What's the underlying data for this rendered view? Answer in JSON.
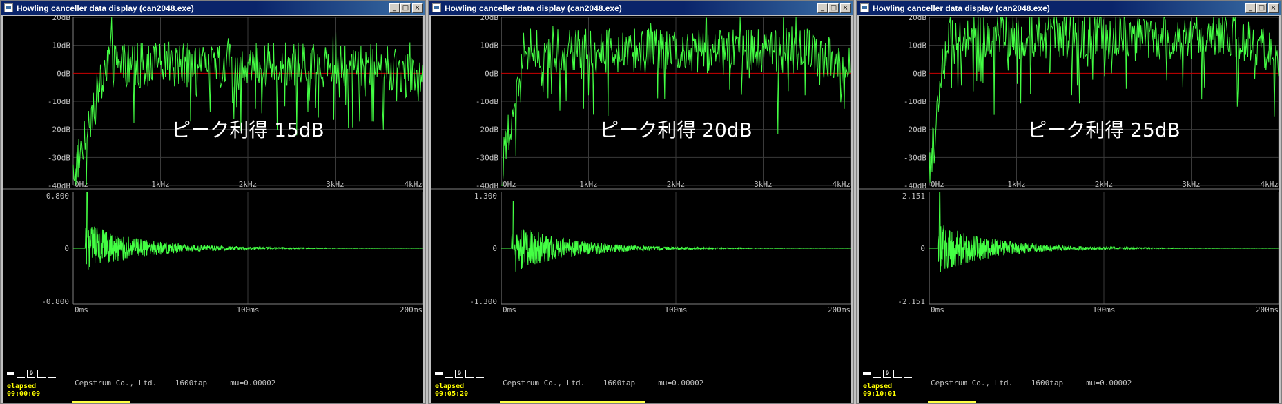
{
  "title_prefix": "Howling canceller data display (can2048.exe)",
  "window_buttons": {
    "minimize": "_",
    "maximize": "□",
    "close": "×"
  },
  "colors": {
    "trace": "#44ff44",
    "zero_line": "#cc0000",
    "grid": "#3a3a3a",
    "axis_text": "#c0c0c0",
    "elapsed_text": "#ffff00"
  },
  "status_icons": [
    "▬",
    "_",
    "9",
    "_",
    "_"
  ],
  "windows": [
    {
      "title": "Howling canceller data display (can2048.exe)",
      "overlay_label": "ピーク利得 15dB",
      "company": "Cepstrum Co., Ltd.",
      "taps": "1600tap",
      "mu": "mu=0.00002",
      "elapsed_label": "elapsed",
      "elapsed_time": "09:00:09",
      "progress_fraction": 0.17,
      "spectrum": {
        "y_ticks": [
          "20dB",
          "10dB",
          "0dB",
          "-10dB",
          "-20dB",
          "-30dB",
          "-40dB"
        ],
        "x_ticks": [
          "0Hz",
          "1kHz",
          "2kHz",
          "3kHz",
          "4kHz"
        ],
        "ylim": [
          -40,
          20
        ],
        "xlim": [
          0,
          4000
        ],
        "peak_db": 15,
        "rise_hz": 450
      },
      "cepstrum": {
        "y_ticks": [
          "0.800",
          "0",
          "-0.800"
        ],
        "x_ticks": [
          "0ms",
          "100ms",
          "200ms"
        ],
        "ylim": [
          -0.8,
          0.8
        ],
        "xlim": [
          0,
          200
        ],
        "peak_value": 0.8,
        "peak_ms": 8
      }
    },
    {
      "title": "Howling canceller data display (can2048.exe)",
      "overlay_label": "ピーク利得 20dB",
      "company": "Cepstrum Co., Ltd.",
      "taps": "1600tap",
      "mu": "mu=0.00002",
      "elapsed_label": "elapsed",
      "elapsed_time": "09:05:20",
      "progress_fraction": 0.42,
      "spectrum": {
        "y_ticks": [
          "20dB",
          "10dB",
          "0dB",
          "-10dB",
          "-20dB",
          "-30dB",
          "-40dB"
        ],
        "x_ticks": [
          "0Hz",
          "1kHz",
          "2kHz",
          "3kHz",
          "4kHz"
        ],
        "ylim": [
          -40,
          20
        ],
        "xlim": [
          0,
          4000
        ],
        "peak_db": 20,
        "rise_hz": 300
      },
      "cepstrum": {
        "y_ticks": [
          "1.300",
          "0",
          "-1.300"
        ],
        "x_ticks": [
          "0ms",
          "100ms",
          "200ms"
        ],
        "ylim": [
          -1.3,
          1.3
        ],
        "xlim": [
          0,
          200
        ],
        "peak_value": 1.1,
        "peak_ms": 7
      }
    },
    {
      "title": "Howling canceller data display (can2048.exe)",
      "overlay_label": "ピーク利得 25dB",
      "company": "Cepstrum Co., Ltd.",
      "taps": "1600tap",
      "mu": "mu=0.00002",
      "elapsed_label": "elapsed",
      "elapsed_time": "09:10:01",
      "progress_fraction": 0.14,
      "spectrum": {
        "y_ticks": [
          "20dB",
          "10dB",
          "0dB",
          "-10dB",
          "-20dB",
          "-30dB",
          "-40dB"
        ],
        "x_ticks": [
          "0Hz",
          "1kHz",
          "2kHz",
          "3kHz",
          "4kHz"
        ],
        "ylim": [
          -40,
          20
        ],
        "xlim": [
          0,
          4000
        ],
        "peak_db": 25,
        "rise_hz": 250
      },
      "cepstrum": {
        "y_ticks": [
          "2.151",
          "0",
          "-2.151"
        ],
        "x_ticks": [
          "0ms",
          "100ms",
          "200ms"
        ],
        "ylim": [
          -2.151,
          2.151
        ],
        "xlim": [
          0,
          200
        ],
        "peak_value": 2.151,
        "peak_ms": 6
      }
    }
  ]
}
